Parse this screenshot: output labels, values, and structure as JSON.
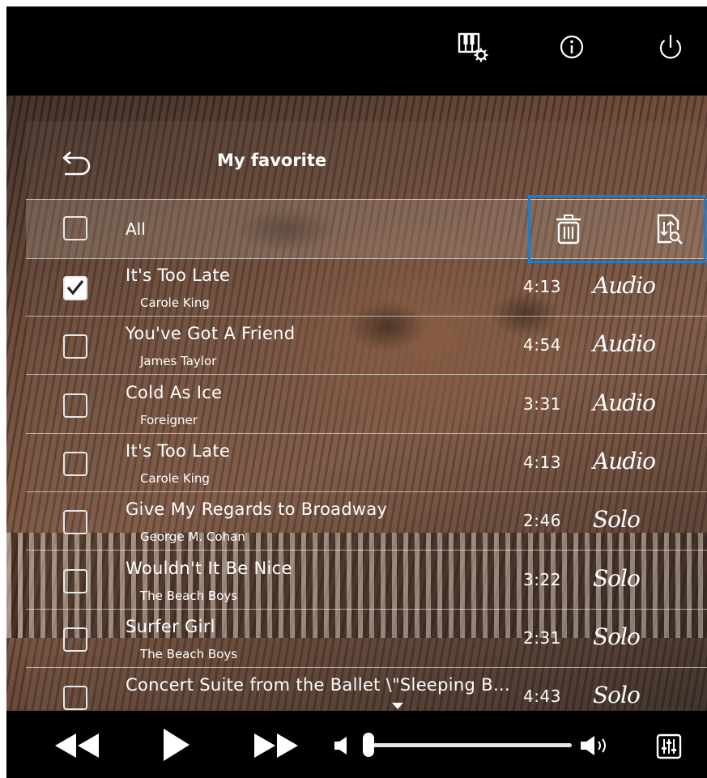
{
  "header": {
    "title": "My favorite"
  },
  "select_all": {
    "label": "All",
    "checked": false
  },
  "songs": [
    {
      "title": "It's Too Late",
      "artist": "Carole King",
      "duration": "4:13",
      "type": "Audio",
      "checked": true
    },
    {
      "title": "You've Got A Friend",
      "artist": "James Taylor",
      "duration": "4:54",
      "type": "Audio",
      "checked": false
    },
    {
      "title": "Cold As Ice",
      "artist": "Foreigner",
      "duration": "3:31",
      "type": "Audio",
      "checked": false
    },
    {
      "title": "It's Too Late",
      "artist": "Carole King",
      "duration": "4:13",
      "type": "Audio",
      "checked": false
    },
    {
      "title": "Give My Regards to Broadway",
      "artist": "George M. Cohan",
      "duration": "2:46",
      "type": "Solo",
      "checked": false
    },
    {
      "title": "Wouldn't It Be Nice",
      "artist": "The Beach Boys",
      "duration": "3:22",
      "type": "Solo",
      "checked": false
    },
    {
      "title": "Surfer Girl",
      "artist": "The Beach Boys",
      "duration": "2:31",
      "type": "Solo",
      "checked": false
    },
    {
      "title": "Concert Suite from the Ballet \\\"Sleeping B…",
      "artist": "",
      "duration": "4:43",
      "type": "Solo",
      "checked": false
    }
  ],
  "icons": {
    "top": [
      "piano-settings-icon",
      "info-icon",
      "power-icon"
    ],
    "actions": [
      "trash-icon",
      "sort-icon"
    ],
    "transport": [
      "rewind-icon",
      "play-icon",
      "fast-forward-icon",
      "volume-low-icon",
      "volume-high-icon",
      "mixer-icon"
    ]
  },
  "volume": {
    "level": 0
  },
  "colors": {
    "selection_outline": "#1a7fd4"
  }
}
